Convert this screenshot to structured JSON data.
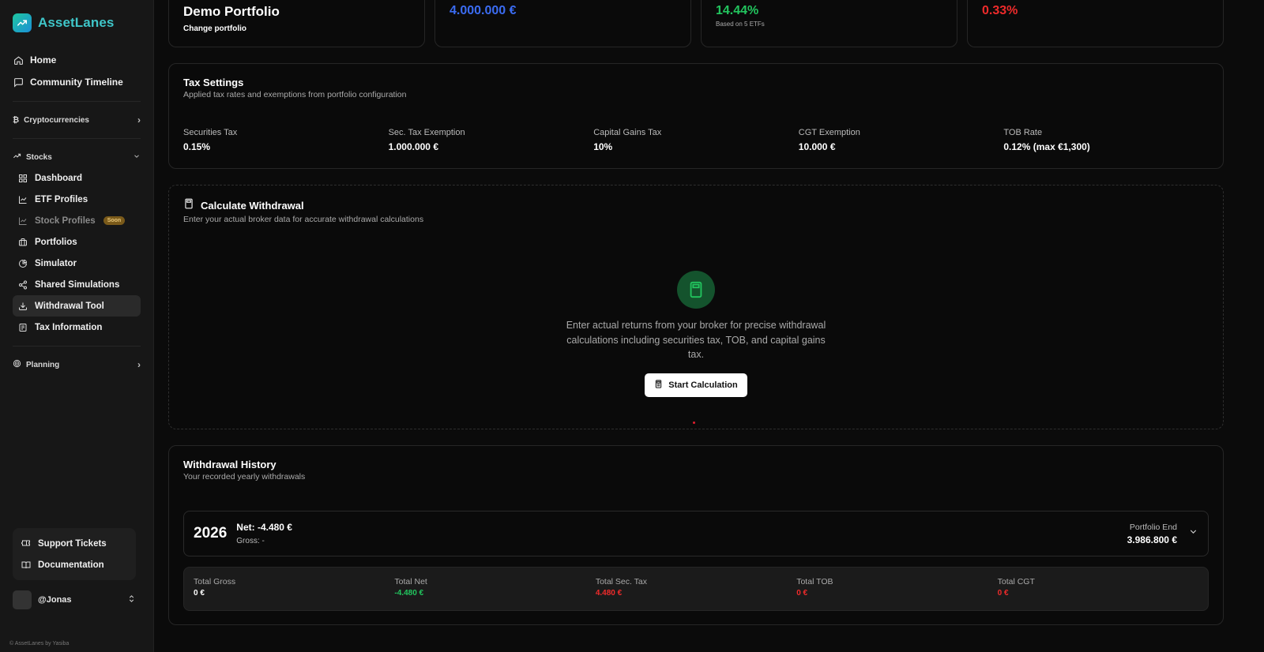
{
  "brand": {
    "name": "AssetLanes"
  },
  "nav": {
    "home": "Home",
    "community": "Community Timeline",
    "crypto": "Cryptocurrencies",
    "stocks": "Stocks",
    "stocks_items": [
      {
        "label": "Dashboard"
      },
      {
        "label": "ETF Profiles"
      },
      {
        "label": "Stock Profiles",
        "badge": "Soon"
      },
      {
        "label": "Portfolios"
      },
      {
        "label": "Simulator"
      },
      {
        "label": "Shared Simulations"
      },
      {
        "label": "Withdrawal Tool"
      },
      {
        "label": "Tax Information"
      }
    ],
    "planning": "Planning",
    "support": "Support Tickets",
    "docs": "Documentation"
  },
  "user": {
    "name": "@Jonas"
  },
  "copyright": "© AssetLanes by Yasiba",
  "top_cards": {
    "portfolio_title": "Demo Portfolio",
    "change_portfolio": "Change portfolio",
    "value": "4.000.000 €",
    "return_value": "14.44%",
    "return_note": "Based on 5 ETFs",
    "ter_value": "0.33%"
  },
  "tax_settings": {
    "title": "Tax Settings",
    "desc": "Applied tax rates and exemptions from portfolio configuration",
    "items": [
      {
        "label": "Securities Tax",
        "value": "0.15%"
      },
      {
        "label": "Sec. Tax Exemption",
        "value": "1.000.000 €"
      },
      {
        "label": "Capital Gains Tax",
        "value": "10%"
      },
      {
        "label": "CGT Exemption",
        "value": "10.000 €"
      },
      {
        "label": "TOB Rate",
        "value": "0.12% (max €1,300)"
      }
    ]
  },
  "calculate": {
    "title": "Calculate Withdrawal",
    "desc": "Enter your actual broker data for accurate withdrawal calculations",
    "text": "Enter actual returns from your broker for precise withdrawal calculations including securities tax, TOB, and capital gains tax.",
    "button": "Start Calculation"
  },
  "history": {
    "title": "Withdrawal History",
    "desc": "Your recorded yearly withdrawals",
    "row": {
      "year": "2026",
      "net": "Net: -4.480 €",
      "gross": "Gross: -",
      "portfolio_end_label": "Portfolio End",
      "portfolio_end_value": "3.986.800 €"
    },
    "totals": [
      {
        "label": "Total Gross",
        "value": "0 €",
        "color": "#ffffff"
      },
      {
        "label": "Total Net",
        "value": "-4.480 €",
        "color": "#22c55e"
      },
      {
        "label": "Total Sec. Tax",
        "value": "4.480 €",
        "color": "#ef2b2b"
      },
      {
        "label": "Total TOB",
        "value": "0 €",
        "color": "#ef2b2b"
      },
      {
        "label": "Total CGT",
        "value": "0 €",
        "color": "#ef2b2b"
      }
    ]
  }
}
